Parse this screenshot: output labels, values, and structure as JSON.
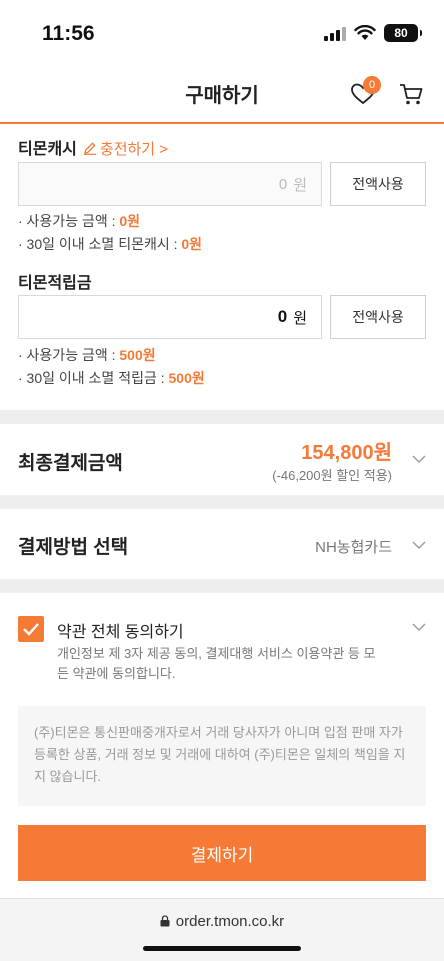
{
  "status": {
    "time": "11:56",
    "battery": "80"
  },
  "header": {
    "title": "구매하기",
    "wishlist_count": "0"
  },
  "cash": {
    "label": "티몬캐시",
    "charge_link": "충전하기",
    "amount": "0",
    "unit": "원",
    "use_all": "전액사용",
    "available_label": "· 사용가능 금액 : ",
    "available_value": "0원",
    "expiring_label": "· 30일 이내 소멸 티몬캐시 : ",
    "expiring_value": "0원"
  },
  "points": {
    "label": "티몬적립금",
    "amount": "0",
    "unit": "원",
    "use_all": "전액사용",
    "available_label": "· 사용가능 금액 : ",
    "available_value": "500원",
    "expiring_label": "· 30일 이내 소멸 적립금 : ",
    "expiring_value": "500원"
  },
  "final": {
    "label": "최종결제금액",
    "price": "154,800원",
    "discount": "(-46,200원 할인 적용)"
  },
  "payment": {
    "label": "결제방법 선택",
    "selected": "NH농협카드"
  },
  "terms": {
    "title": "약관 전체 동의하기",
    "description": "개인정보 제 3자 제공 동의, 결제대행 서비스 이용약관 등 모든 약관에 동의합니다.",
    "checked": true
  },
  "disclaimer": "(주)티몬은 통신판매중개자로서 거래 당사자가 아니며 입점 판매 자가 등록한 상품, 거래 정보 및 거래에 대하여 (주)티몬은 일체의 책임을 지지 않습니다.",
  "pay_button": "결제하기",
  "browser": {
    "url": "order.tmon.co.kr"
  },
  "colors": {
    "accent": "#f47a36",
    "divider": "#eeeeee"
  }
}
